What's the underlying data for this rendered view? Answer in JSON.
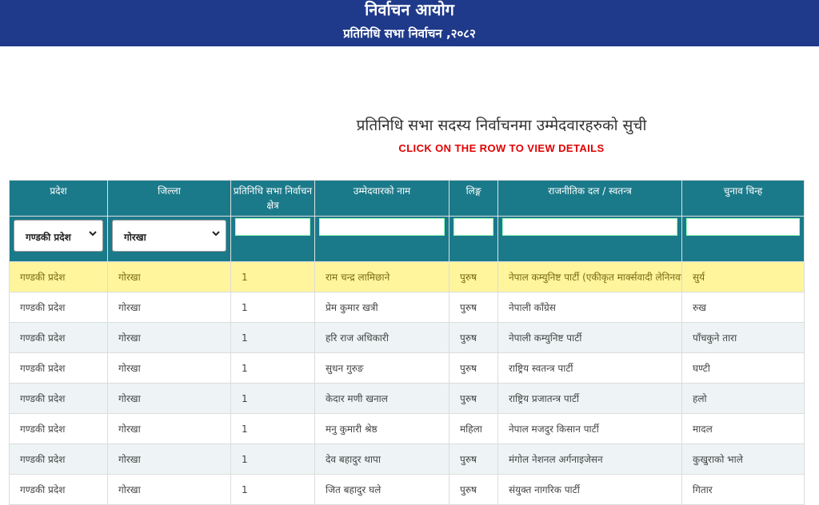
{
  "header": {
    "title": "निर्वाचन आयोग",
    "subtitle": "प्रतिनिधि सभा निर्वाचन ,२०८२"
  },
  "main": {
    "page_title": "प्रतिनिधि सभा सदस्य निर्वाचनमा उम्मेदवारहरुको सुची",
    "click_hint": "CLICK ON THE ROW TO VIEW DETAILS"
  },
  "table": {
    "columns": [
      "प्रदेश",
      "जिल्ला",
      "प्रतिनिधि सभा निर्वाचन क्षेत्र",
      "उम्मेदवारको नाम",
      "लिङ्ग",
      "राजनीतिक दल / स्वतन्त्र",
      "चुनाव चिन्ह"
    ],
    "filters": {
      "province_value": "गण्डकी प्रदेश",
      "district_value": "गोरखा"
    },
    "rows": [
      [
        "गण्डकी प्रदेश",
        "गोरखा",
        "1",
        "राम चन्द्र लामिछाने",
        "पुरुष",
        "नेपाल कम्युनिष्ट पार्टी (एकीकृत मार्क्सवादी लेनिनवादी)",
        "सुर्य"
      ],
      [
        "गण्डकी प्रदेश",
        "गोरखा",
        "1",
        "प्रेम कुमार खत्री",
        "पुरुष",
        "नेपाली काँग्रेस",
        "रुख"
      ],
      [
        "गण्डकी प्रदेश",
        "गोरखा",
        "1",
        "हरि राज अधिकारी",
        "पुरुष",
        "नेपाली कम्युनिष्ट पार्टी",
        "पाँचकुने तारा"
      ],
      [
        "गण्डकी प्रदेश",
        "गोरखा",
        "1",
        "सुधन गुरुङ",
        "पुरुष",
        "राष्ट्रिय स्वतन्त्र पार्टी",
        "घण्टी"
      ],
      [
        "गण्डकी प्रदेश",
        "गोरखा",
        "1",
        "केदार मणी खनाल",
        "पुरुष",
        "राष्ट्रिय प्रजातन्त्र पार्टी",
        "हलो"
      ],
      [
        "गण्डकी प्रदेश",
        "गोरखा",
        "1",
        "मनु कुमारी श्रेष्ठ",
        "महिला",
        "नेपाल मजदुर किसान पार्टी",
        "मादल"
      ],
      [
        "गण्डकी प्रदेश",
        "गोरखा",
        "1",
        "देव बहादुर थापा",
        "पुरुष",
        "मंगोल नेशनल अर्गनाइजेसन",
        "कुखुराको भाले"
      ],
      [
        "गण्डकी प्रदेश",
        "गोरखा",
        "1",
        "जित बहादुर घले",
        "पुरुष",
        "संयुक्त नागरिक पार्टी",
        "गितार"
      ]
    ]
  },
  "colors": {
    "header_bg": "#1f3a8a",
    "table_header_bg": "#1b7a8a",
    "highlight_row": "#fff59d",
    "hint_red": "#e00000"
  }
}
